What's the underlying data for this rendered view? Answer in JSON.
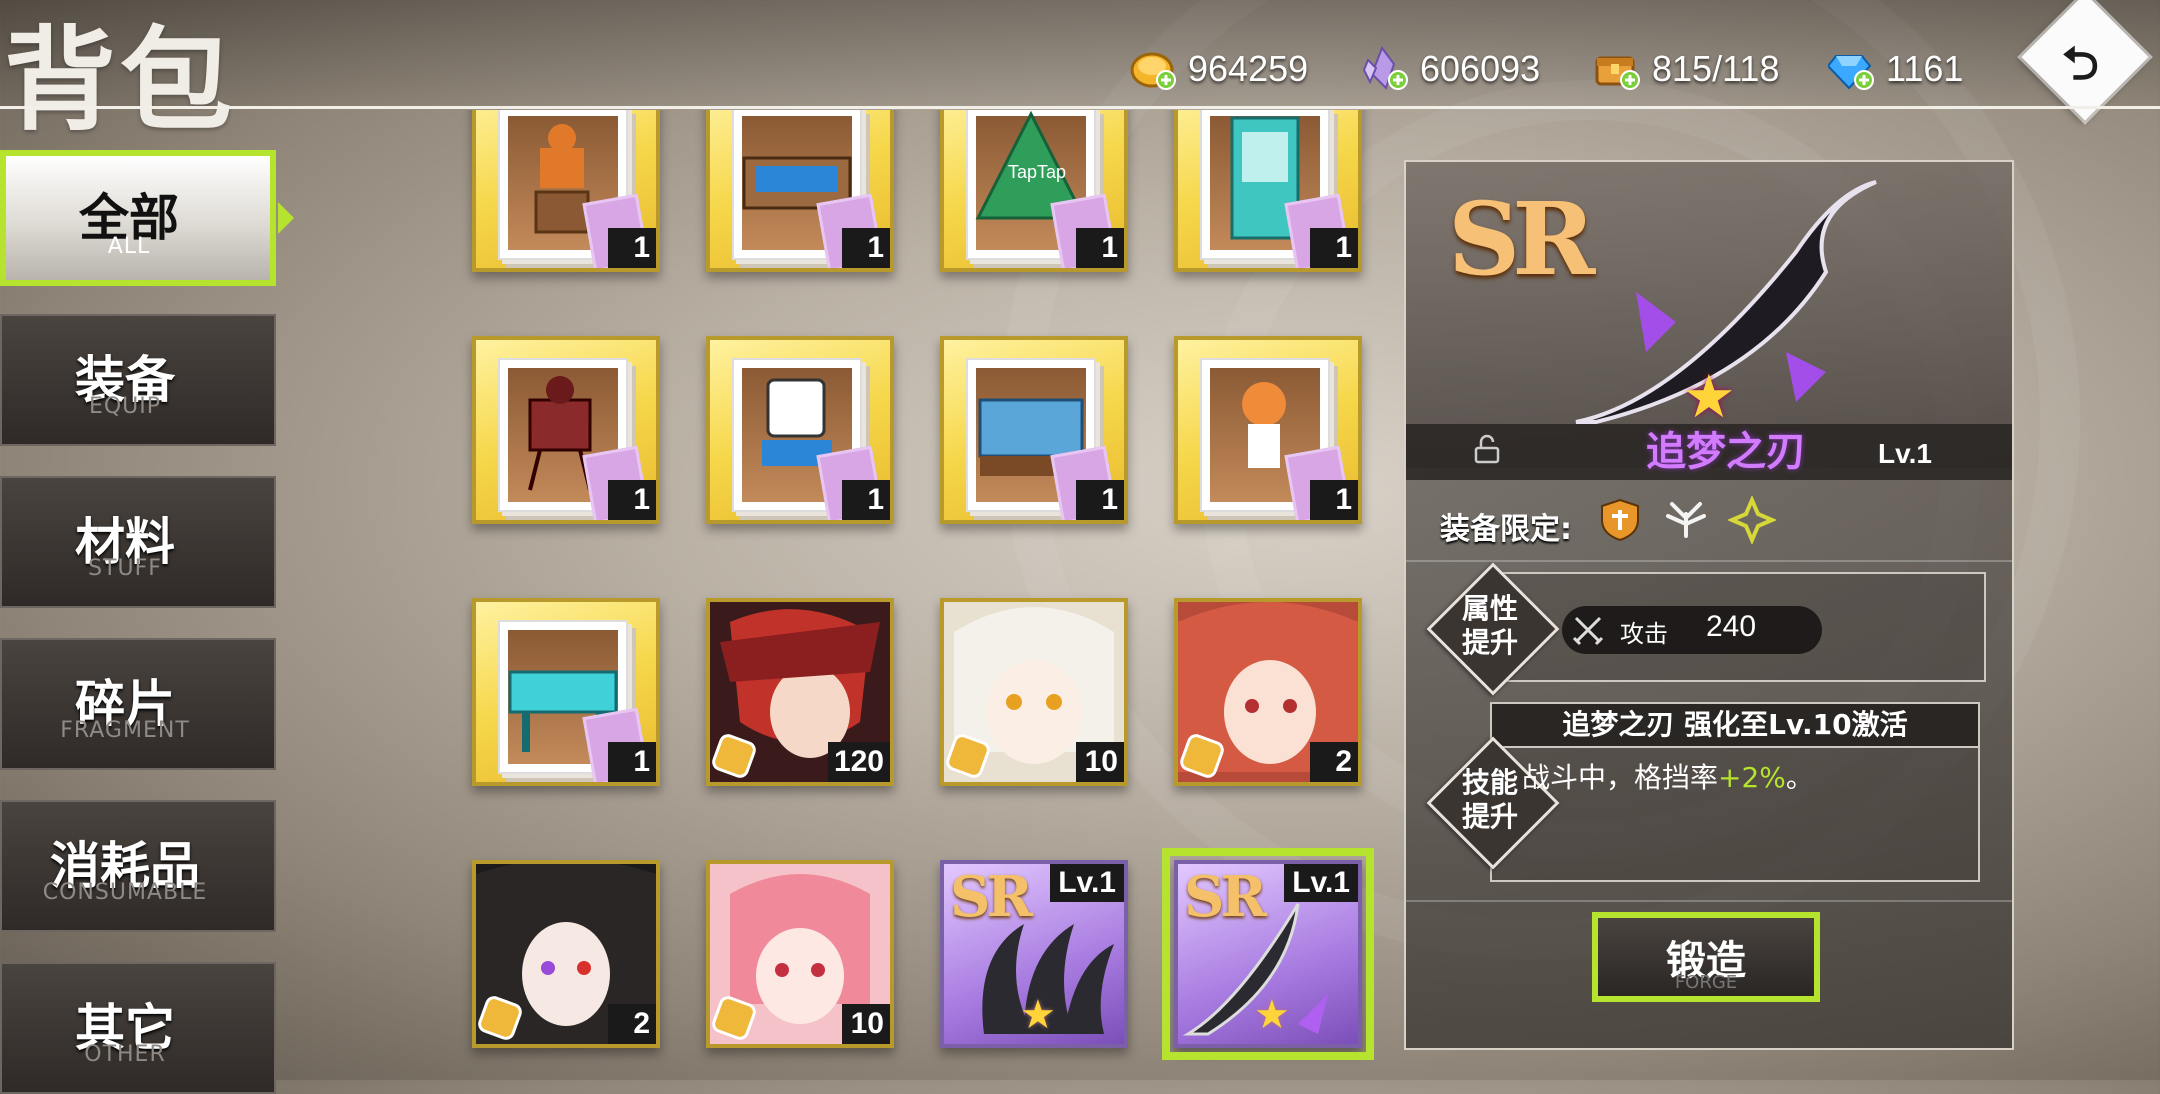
{
  "header": {
    "title": "背包",
    "resources": [
      {
        "icon": "gold-coin-icon",
        "value": "964259"
      },
      {
        "icon": "purple-crystal-icon",
        "value": "606093"
      },
      {
        "icon": "treasure-chest-icon",
        "value": "815/118"
      },
      {
        "icon": "diamond-icon",
        "value": "1161"
      }
    ]
  },
  "sidebar": {
    "items": [
      {
        "zh": "全部",
        "en": "ALL",
        "active": true
      },
      {
        "zh": "装备",
        "en": "EQUIP"
      },
      {
        "zh": "材料",
        "en": "STUFF"
      },
      {
        "zh": "碎片",
        "en": "FRAGMENT"
      },
      {
        "zh": "消耗品",
        "en": "CONSUMABLE"
      },
      {
        "zh": "其它",
        "en": "OTHER"
      }
    ]
  },
  "grid": {
    "items": [
      {
        "name": "furniture-card-robot-statue",
        "count": "1"
      },
      {
        "name": "furniture-card-air-hockey",
        "count": "1"
      },
      {
        "name": "furniture-card-taptap-tree",
        "count": "1"
      },
      {
        "name": "furniture-card-claw-machine",
        "count": "1"
      },
      {
        "name": "furniture-card-projector",
        "count": "1"
      },
      {
        "name": "furniture-card-cube-stool",
        "count": "1"
      },
      {
        "name": "furniture-card-sofa",
        "count": "1"
      },
      {
        "name": "furniture-card-figurine",
        "count": "1"
      },
      {
        "name": "furniture-card-taptap-table",
        "count": "1"
      },
      {
        "name": "fragment-red-hat-girl",
        "count": "120"
      },
      {
        "name": "fragment-white-hair-girl",
        "count": "10"
      },
      {
        "name": "fragment-red-hair-girl",
        "count": "2"
      },
      {
        "name": "fragment-black-hair-girl",
        "count": "2"
      },
      {
        "name": "fragment-pink-hair-girl",
        "count": "10"
      },
      {
        "name": "equip-sr-claw",
        "rarity": "SR",
        "level": "Lv.1"
      },
      {
        "name": "equip-sr-blade",
        "rarity": "SR",
        "level": "Lv.1",
        "selected": true
      }
    ]
  },
  "detail": {
    "rarity": "SR",
    "name": "追梦之刃",
    "level": "Lv.1",
    "equip_limit_label": "装备限定:",
    "attr_section_label": [
      "属性",
      "提升"
    ],
    "stat": {
      "label": "攻击",
      "value": "240"
    },
    "skill_section_label": [
      "技能",
      "提升"
    ],
    "skill_title": "追梦之刃 强化至Lv.10激活",
    "skill_desc_prefix": "战斗中，格挡率",
    "skill_desc_value": "+2%",
    "skill_desc_suffix": "。",
    "forge": {
      "zh": "锻造",
      "en": "FORGE"
    }
  },
  "colors": {
    "accent": "#b6e32e",
    "sr_gold": "#f6c076",
    "name_purple": "#d27bff"
  }
}
